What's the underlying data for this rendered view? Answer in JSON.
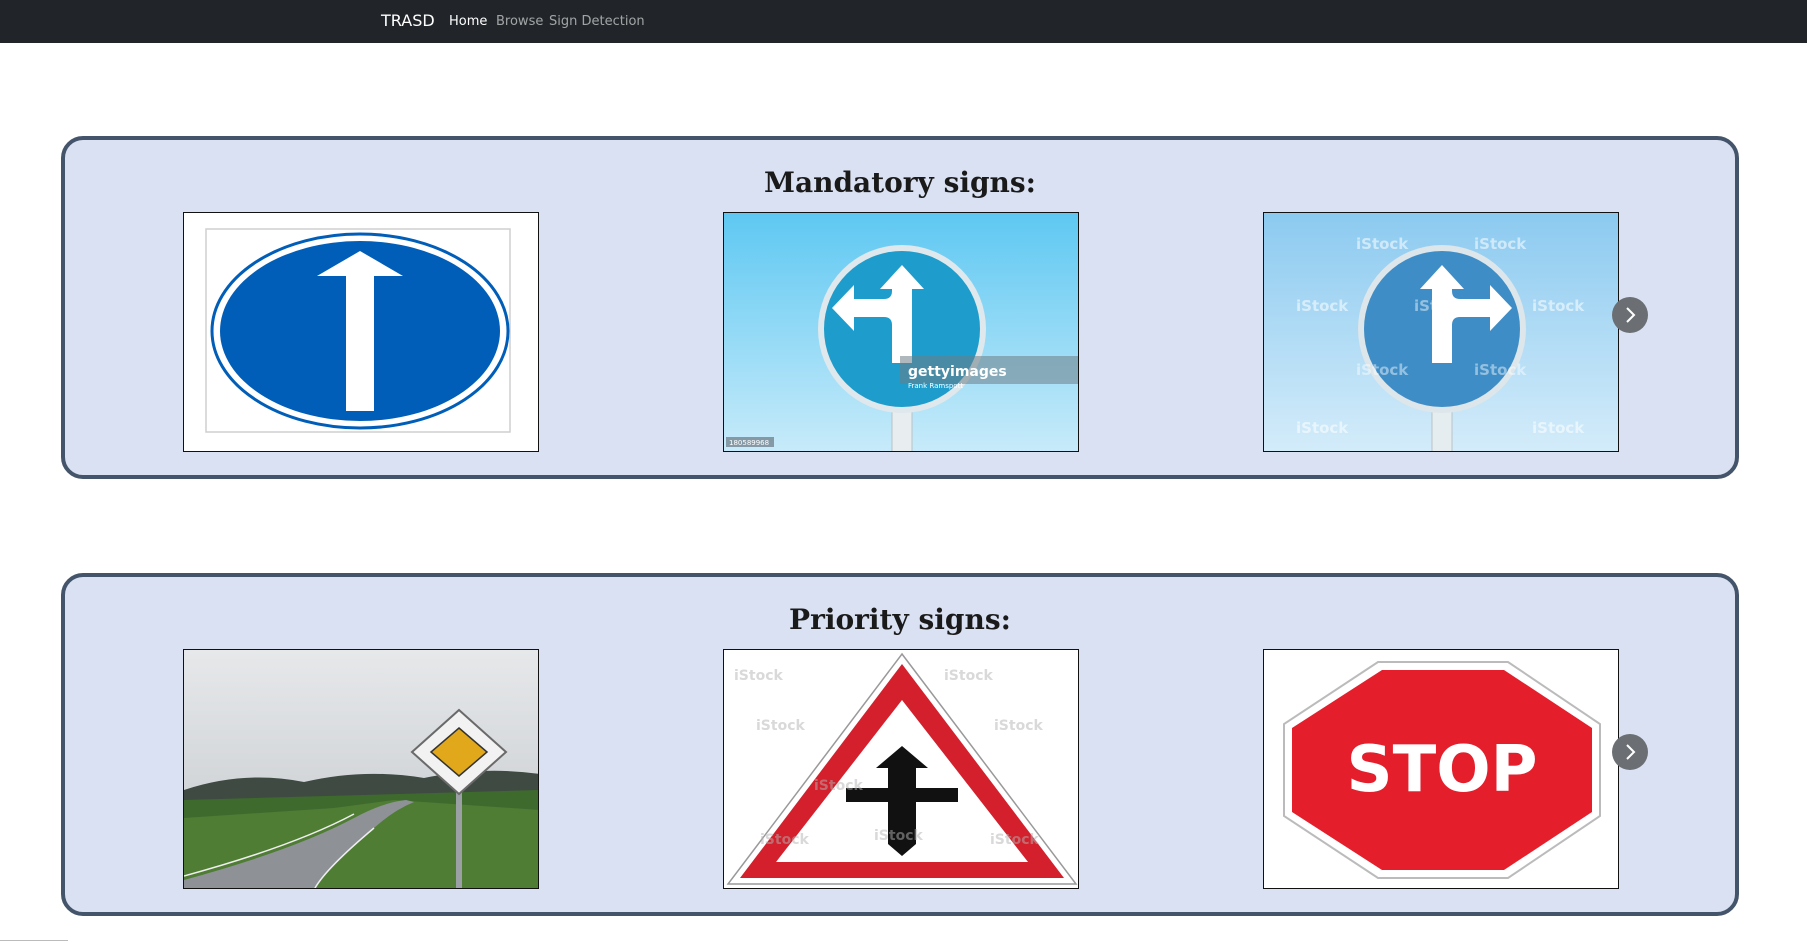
{
  "navbar": {
    "brand": "TRASD",
    "links": [
      {
        "label": "Home",
        "active": true
      },
      {
        "label": "Browse",
        "active": false
      },
      {
        "label": "Sign Detection",
        "active": false
      }
    ]
  },
  "sections": [
    {
      "title": "Mandatory signs:",
      "images": [
        {
          "icon": "ahead-only-sign-icon"
        },
        {
          "icon": "ahead-or-left-sign-icon",
          "watermark": "gettyimages",
          "credit": "Frank Ramspott",
          "code": "180589968"
        },
        {
          "icon": "ahead-or-right-sign-icon",
          "watermark": "iStock"
        }
      ],
      "next_icon": "chevron-right-icon"
    },
    {
      "title": "Priority signs:",
      "images": [
        {
          "icon": "priority-road-sign-icon"
        },
        {
          "icon": "crossroads-priority-sign-icon",
          "watermark": "iStock"
        },
        {
          "icon": "stop-sign-icon",
          "text": "STOP"
        }
      ],
      "next_icon": "chevron-right-icon"
    }
  ],
  "colors": {
    "navbar": "#212529",
    "panel_bg": "#d9e1f2",
    "panel_border": "#44546a",
    "sign_blue": "#005eb8",
    "stop_red": "#e41e2b"
  }
}
